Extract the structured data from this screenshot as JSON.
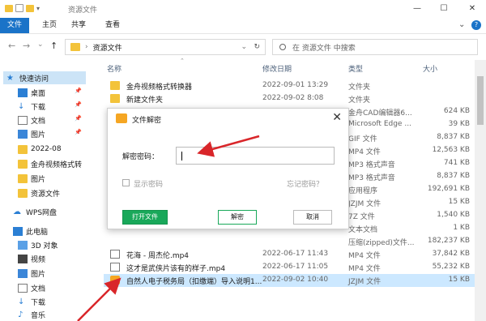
{
  "window": {
    "title": "资源文件",
    "minimize": "—",
    "maximize": "☐",
    "close": "✕"
  },
  "ribbon": {
    "tabs": [
      "文件",
      "主页",
      "共享",
      "查看"
    ]
  },
  "address": {
    "back": "←",
    "forward": "→",
    "dropdown": "⌄",
    "up": "↑",
    "crumb_sep": "›",
    "path": "资源文件",
    "refresh": "↻",
    "search_placeholder": "在 资源文件 中搜索"
  },
  "nav": {
    "items": [
      {
        "label": "快速访问",
        "icon": "star-icon"
      },
      {
        "label": "桌面",
        "icon": "desktop-icon",
        "pinned": true
      },
      {
        "label": "下载",
        "icon": "download-icon",
        "pinned": true
      },
      {
        "label": "文档",
        "icon": "document-icon",
        "pinned": true
      },
      {
        "label": "图片",
        "icon": "picture-icon",
        "pinned": true
      },
      {
        "label": "2022-08",
        "icon": "folder-icon"
      },
      {
        "label": "金舟视频格式转",
        "icon": "folder-icon"
      },
      {
        "label": "图片",
        "icon": "folder-icon"
      },
      {
        "label": "资源文件",
        "icon": "folder-icon"
      },
      {
        "label": "WPS网盘",
        "icon": "cloud-icon"
      },
      {
        "label": "此电脑",
        "icon": "computer-icon"
      },
      {
        "label": "3D 对象",
        "icon": "3d-objects-icon"
      },
      {
        "label": "视频",
        "icon": "video-icon"
      },
      {
        "label": "图片",
        "icon": "picture-icon"
      },
      {
        "label": "文档",
        "icon": "document-icon"
      },
      {
        "label": "下载",
        "icon": "download-icon"
      },
      {
        "label": "音乐",
        "icon": "music-icon"
      }
    ],
    "pin_glyph": "📌"
  },
  "columns": {
    "name": "名称",
    "date": "修改日期",
    "type": "类型",
    "size": "大小"
  },
  "files": [
    {
      "name": "金舟视频格式转换器",
      "date": "2022-09-01 13:29",
      "type": "文件夹",
      "size": "",
      "icon": "folder-icon"
    },
    {
      "name": "新建文件夹",
      "date": "2022-09-02 8:08",
      "type": "文件夹",
      "size": "",
      "icon": "folder-icon"
    },
    {
      "name": "",
      "date": "",
      "type": "金舟CAD编辑器6...",
      "size": "624 KB",
      "icon": ""
    },
    {
      "name": "",
      "date": "",
      "type": "Microsoft Edge ...",
      "size": "39 KB",
      "icon": ""
    },
    {
      "name": "",
      "date": "",
      "type": "GIF 文件",
      "size": "8,837 KB",
      "icon": ""
    },
    {
      "name": "",
      "date": "",
      "type": "MP4 文件",
      "size": "12,563 KB",
      "icon": ""
    },
    {
      "name": "",
      "date": "",
      "type": "MP3 格式声音",
      "size": "741 KB",
      "icon": ""
    },
    {
      "name": "",
      "date": "",
      "type": "MP3 格式声音",
      "size": "8,837 KB",
      "icon": ""
    },
    {
      "name": "",
      "date": "",
      "type": "应用程序",
      "size": "192,691 KB",
      "icon": ""
    },
    {
      "name": "",
      "date": "",
      "type": "JZJM 文件",
      "size": "15 KB",
      "icon": ""
    },
    {
      "name": "",
      "date": "",
      "type": "7Z 文件",
      "size": "1,540 KB",
      "icon": ""
    },
    {
      "name": "",
      "date": "",
      "type": "文本文档",
      "size": "1 KB",
      "icon": ""
    },
    {
      "name": "",
      "date": "",
      "type": "压缩(zipped)文件...",
      "size": "182,237 KB",
      "icon": ""
    },
    {
      "name": "花海 - 周杰伦.mp4",
      "date": "2022-06-17 11:43",
      "type": "MP4 文件",
      "size": "37,842 KB",
      "icon": "video-file-icon"
    },
    {
      "name": "这才是武侠片该有的样子.mp4",
      "date": "2022-06-17 11:05",
      "type": "MP4 文件",
      "size": "55,232 KB",
      "icon": "video-file-icon"
    },
    {
      "name": "自然人电子税务局（扣缴端）导入说明1...",
      "date": "2022-09-02 10:40",
      "type": "JZJM 文件",
      "size": "15 KB",
      "icon": "encrypted-file-icon",
      "selected": true
    }
  ],
  "dialog": {
    "title": "文件解密",
    "close": "✕",
    "password_label": "解密密码：",
    "password_value": "",
    "show_password_label": "显示密码",
    "forgot_password": "忘记密码？",
    "open_file_button": "打开文件",
    "decrypt_button": "解密",
    "cancel_button": "取消"
  },
  "colors": {
    "accent": "#1a73c8",
    "annotation_arrow": "#d9262a",
    "primary_button": "#19a85a",
    "selection": "#cce8ff"
  }
}
